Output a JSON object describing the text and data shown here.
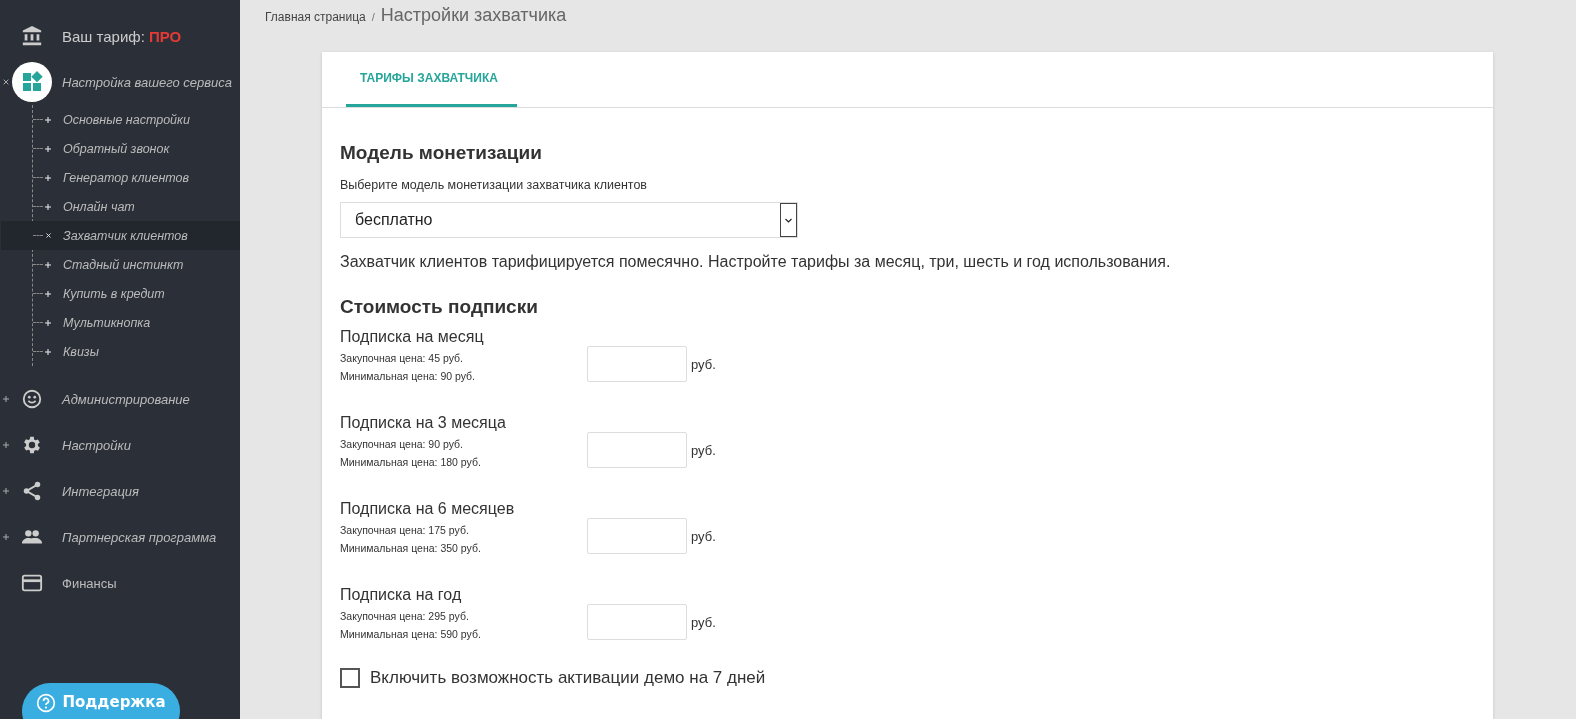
{
  "sidebar": {
    "plan": {
      "label": "Ваш тариф:",
      "value": "ПРО"
    },
    "nav": [
      {
        "kind": "group",
        "label": "Настройка вашего сервиса",
        "expanded": true,
        "children": [
          {
            "label": "Основные настройки",
            "selected": false
          },
          {
            "label": "Обратный звонок",
            "selected": false
          },
          {
            "label": "Генератор клиентов",
            "selected": false
          },
          {
            "label": "Онлайн чат",
            "selected": false
          },
          {
            "label": "Захватчик клиентов",
            "selected": true
          },
          {
            "label": "Стадный инстинкт",
            "selected": false
          },
          {
            "label": "Купить в кредит",
            "selected": false
          },
          {
            "label": "Мультикнопка",
            "selected": false
          },
          {
            "label": "Квизы",
            "selected": false
          }
        ]
      },
      {
        "kind": "group",
        "label": "Администрирование",
        "expanded": false
      },
      {
        "kind": "group",
        "label": "Настройки",
        "expanded": false
      },
      {
        "kind": "group",
        "label": "Интеграция",
        "expanded": false
      },
      {
        "kind": "group",
        "label": "Партнерская программа",
        "expanded": false
      },
      {
        "kind": "link",
        "label": "Финансы"
      }
    ],
    "support_button": "Поддержка"
  },
  "breadcrumb": {
    "home": "Главная страница",
    "separator": "/",
    "current": "Настройки захватчика"
  },
  "tabs": [
    {
      "label": "ТАРИФЫ ЗАХВАТЧИКА",
      "selected": true
    }
  ],
  "monetization": {
    "heading": "Модель монетизации",
    "hint": "Выберите модель монетизации захватчика клиентов",
    "select_value": "бесплатно",
    "description": "Захватчик клиентов тарифицируется помесячно. Настройте тарифы за месяц, три, шесть и год использования."
  },
  "pricing": {
    "heading": "Стоимость подписки",
    "plans": [
      {
        "title": "Подписка на месяц",
        "purchase": "Закупочная цена: 45 руб.",
        "minimum": "Минимальная цена: 90 руб.",
        "unit": "руб."
      },
      {
        "title": "Подписка на 3 месяца",
        "purchase": "Закупочная цена: 90 руб.",
        "minimum": "Минимальная цена: 180 руб.",
        "unit": "руб."
      },
      {
        "title": "Подписка на 6 месяцев",
        "purchase": "Закупочная цена: 175 руб.",
        "minimum": "Минимальная цена: 350 руб.",
        "unit": "руб."
      },
      {
        "title": "Подписка на год",
        "purchase": "Закупочная цена: 295 руб.",
        "minimum": "Минимальная цена: 590 руб.",
        "unit": "руб."
      }
    ]
  },
  "demo_option": {
    "label": "Включить возможность активации демо на 7 дней",
    "checked": false
  }
}
